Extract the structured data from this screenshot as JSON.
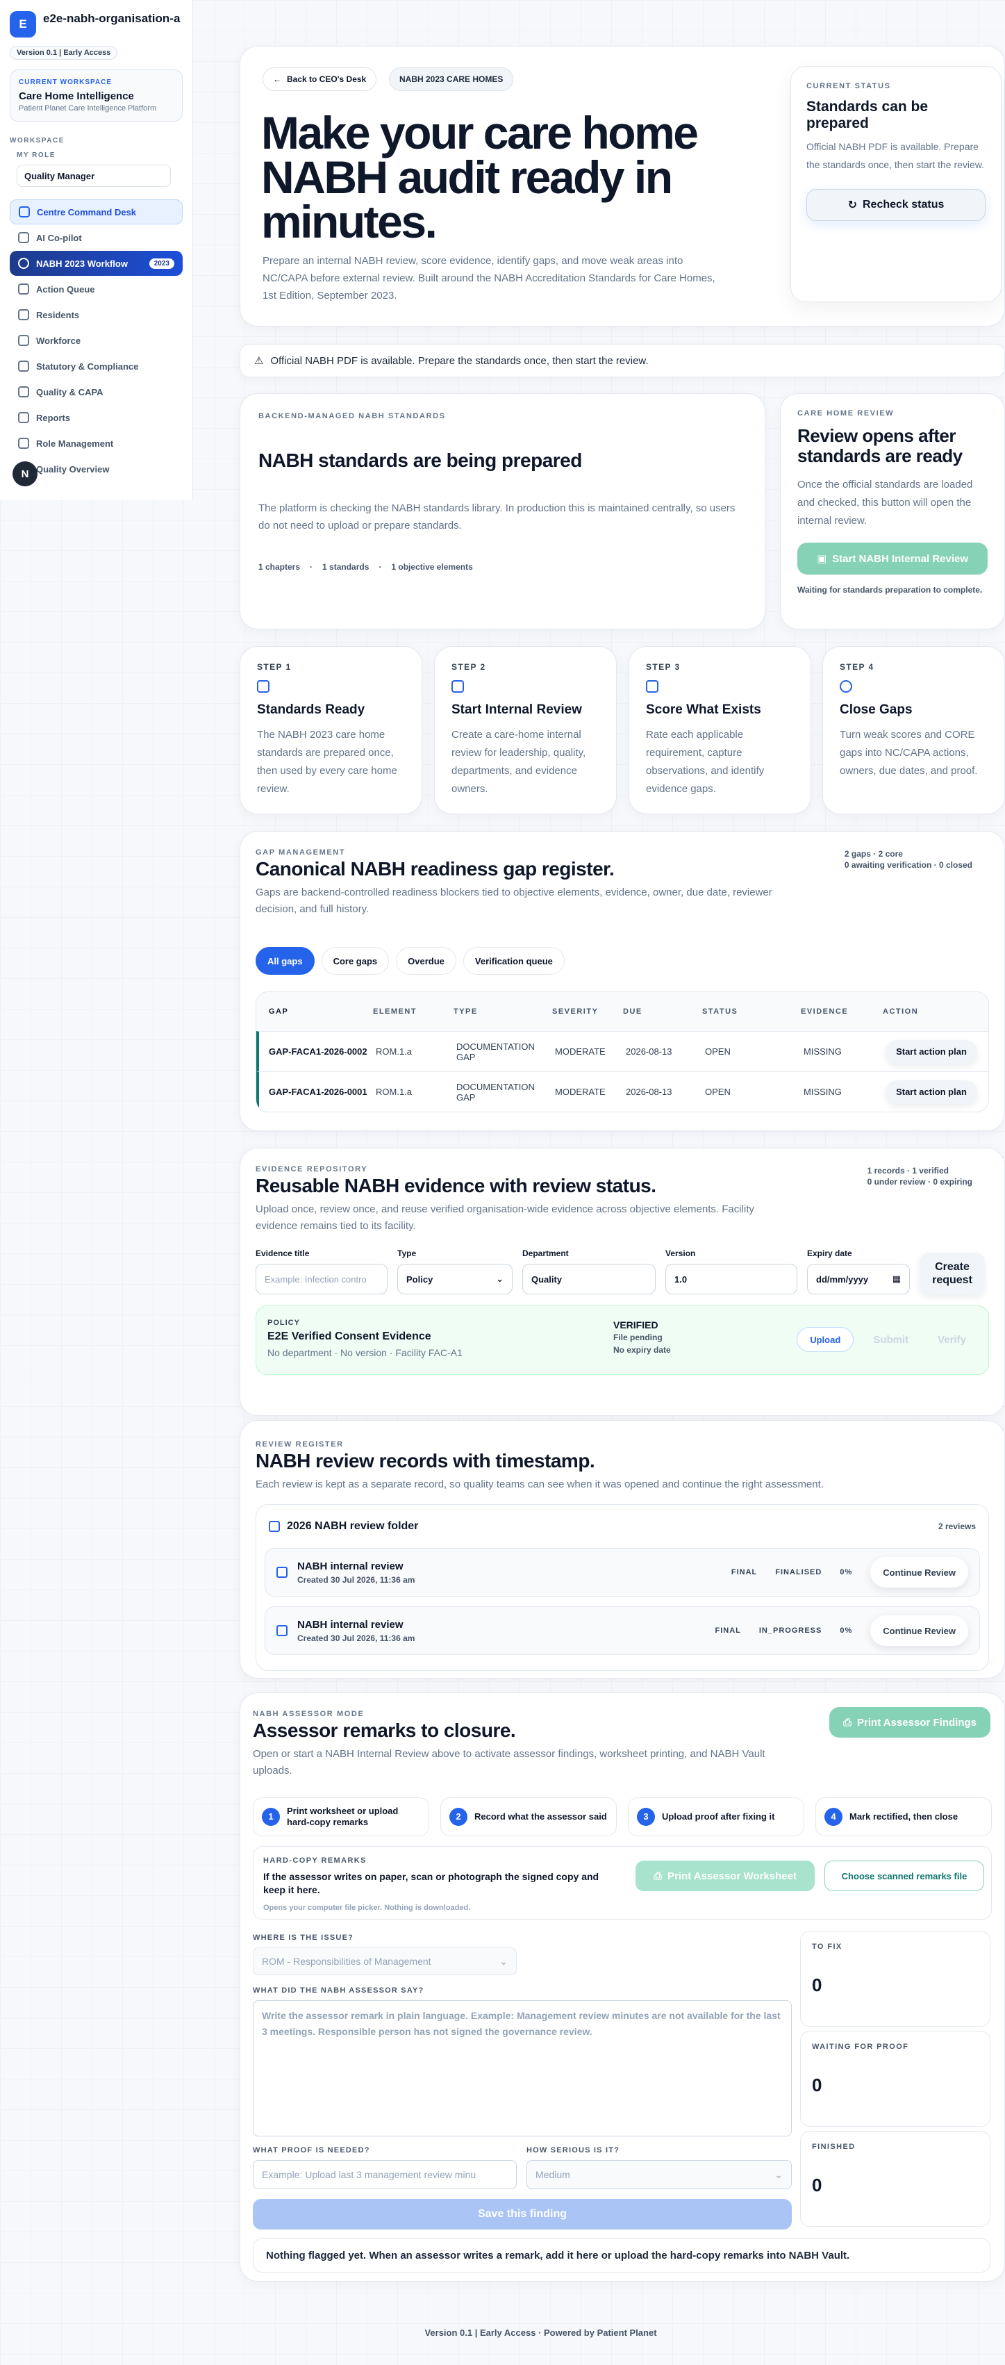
{
  "sidebar": {
    "logo_letter": "E",
    "org_name": "e2e-nabh-organisation-a",
    "version": "Version 0.1 | Early Access",
    "workspace_eyebrow": "CURRENT WORKSPACE",
    "workspace_name": "Care Home Intelligence",
    "workspace_sub": "Patient Planet Care Intelligence Platform",
    "section_label": "WORKSPACE",
    "role_label": "MY ROLE",
    "role_value": "Quality Manager",
    "items": [
      {
        "label": "Centre Command Desk",
        "icon": "grid-icon"
      },
      {
        "label": "AI Co-pilot",
        "icon": "chat-icon"
      },
      {
        "label": "NABH 2023 Workflow",
        "icon": "shield-icon",
        "badge": "2023"
      },
      {
        "label": "Action Queue",
        "icon": "clock-icon"
      },
      {
        "label": "Residents",
        "icon": "users-icon"
      },
      {
        "label": "Workforce",
        "icon": "people-icon"
      },
      {
        "label": "Statutory & Compliance",
        "icon": "shield-check-icon"
      },
      {
        "label": "Quality & CAPA",
        "icon": "quality-icon"
      },
      {
        "label": "Reports",
        "icon": "chart-icon"
      },
      {
        "label": "Role Management",
        "icon": "key-icon"
      },
      {
        "label": "Quality Overview",
        "icon": "overview-icon"
      }
    ],
    "float_badge": "N"
  },
  "hero": {
    "back_label": "Back to CEO's Desk",
    "tag": "NABH 2023 CARE HOMES",
    "title": "Make your care home NABH audit ready in minutes.",
    "description": "Prepare an internal NABH review, score evidence, identify gaps, and move weak areas into NC/CAPA before external review. Built around the NABH Accreditation Standards for Care Homes, 1st Edition, September 2023.",
    "status": {
      "eyebrow": "CURRENT STATUS",
      "title": "Standards can be prepared",
      "description": "Official NABH PDF is available. Prepare the standards once, then start the review.",
      "button": "Recheck status"
    }
  },
  "notice": "Official NABH PDF is available. Prepare the standards once, then start the review.",
  "standards": {
    "eyebrow": "BACKEND-MANAGED NABH STANDARDS",
    "title": "NABH standards are being prepared",
    "description": "The platform is checking the NABH standards library. In production this is maintained centrally, so users do not need to upload or prepare standards.",
    "meta": [
      "1 chapters",
      "1 standards",
      "1 objective elements"
    ]
  },
  "review_card": {
    "eyebrow": "CARE HOME REVIEW",
    "title": "Review opens after standards are ready",
    "description": "Once the official standards are loaded and checked, this button will open the internal review.",
    "button": "Start NABH Internal Review",
    "wait": "Waiting for standards preparation to complete."
  },
  "steps": [
    {
      "eyebrow": "STEP 1",
      "title": "Standards Ready",
      "desc": "The NABH 2023 care home standards are prepared once, then used by every care home review."
    },
    {
      "eyebrow": "STEP 2",
      "title": "Start Internal Review",
      "desc": "Create a care-home internal review for leadership, quality, departments, and evidence owners."
    },
    {
      "eyebrow": "STEP 3",
      "title": "Score What Exists",
      "desc": "Rate each applicable requirement, capture observations, and identify evidence gaps."
    },
    {
      "eyebrow": "STEP 4",
      "title": "Close Gaps",
      "desc": "Turn weak scores and CORE gaps into NC/CAPA actions, owners, due dates, and proof."
    }
  ],
  "gaps": {
    "eyebrow": "GAP MANAGEMENT",
    "title": "Canonical NABH readiness gap register.",
    "description": "Gaps are backend-controlled readiness blockers tied to objective elements, evidence, owner, due date, reviewer decision, and full history.",
    "counts": [
      "2 gaps",
      "2 core",
      "0 awaiting verification",
      "0 closed"
    ],
    "chips": [
      "All gaps",
      "Core gaps",
      "Overdue",
      "Verification queue"
    ],
    "columns": [
      "GAP",
      "ELEMENT",
      "TYPE",
      "SEVERITY",
      "DUE",
      "STATUS",
      "EVIDENCE",
      "ACTION"
    ],
    "rows": [
      {
        "gap": "GAP-FACA1-2026-0002",
        "element": "ROM.1.a",
        "type": "DOCUMENTATION GAP",
        "severity": "MODERATE",
        "due": "2026-08-13",
        "status": "OPEN",
        "evidence": "MISSING",
        "action": "Start action plan"
      },
      {
        "gap": "GAP-FACA1-2026-0001",
        "element": "ROM.1.a",
        "type": "DOCUMENTATION GAP",
        "severity": "MODERATE",
        "due": "2026-08-13",
        "status": "OPEN",
        "evidence": "MISSING",
        "action": "Start action plan"
      }
    ]
  },
  "evidence": {
    "eyebrow": "EVIDENCE REPOSITORY",
    "title": "Reusable NABH evidence with review status.",
    "description": "Upload once, review once, and reuse verified organisation-wide evidence across objective elements. Facility evidence remains tied to its facility.",
    "counts": [
      "1 records",
      "1 verified",
      "0 under review",
      "0 expiring"
    ],
    "form": {
      "title_label": "Evidence title",
      "title_placeholder": "Example: Infection contro",
      "type_label": "Type",
      "type_value": "Policy",
      "dept_label": "Department",
      "dept_value": "Quality",
      "version_label": "Version",
      "version_value": "1.0",
      "expiry_label": "Expiry date",
      "expiry_value": "dd/mm/yyyy",
      "create_button": "Create request"
    },
    "record": {
      "type": "POLICY",
      "name": "E2E Verified Consent Evidence",
      "sub": "No department · No version · Facility FAC-A1",
      "status": "VERIFIED",
      "file": "File pending",
      "expiry": "No expiry date",
      "upload": "Upload",
      "submit": "Submit",
      "verify": "Verify"
    }
  },
  "register": {
    "eyebrow": "REVIEW REGISTER",
    "title": "NABH review records with timestamp.",
    "description": "Each review is kept as a separate record, so quality teams can see when it was opened and continue the right assessment.",
    "folder_title": "2026 NABH review folder",
    "folder_count": "2 reviews",
    "records": [
      {
        "name": "NABH internal review",
        "date": "Created 30 Jul 2026, 11:36 am",
        "tag1": "FINAL",
        "tag2": "FINALISED",
        "pct": "0%",
        "button": "Continue Review"
      },
      {
        "name": "NABH internal review",
        "date": "Created 30 Jul 2026, 11:36 am",
        "tag1": "FINAL",
        "tag2": "IN_PROGRESS",
        "pct": "0%",
        "button": "Continue Review"
      }
    ]
  },
  "assessor": {
    "eyebrow": "NABH ASSESSOR MODE",
    "title": "Assessor remarks to closure.",
    "description": "Open or start a NABH Internal Review above to activate assessor findings, worksheet printing, and NABH Vault uploads.",
    "print_button": "Print Assessor Findings",
    "steps": [
      {
        "num": "1",
        "label": "Print worksheet or upload hard-copy remarks"
      },
      {
        "num": "2",
        "label": "Record what the assessor said"
      },
      {
        "num": "3",
        "label": "Upload proof after fixing it"
      },
      {
        "num": "4",
        "label": "Mark rectified, then close"
      }
    ],
    "hardcopy": {
      "eyebrow": "HARD-COPY REMARKS",
      "text": "If the assessor writes on paper, scan or photograph the signed copy and keep it here.",
      "sub": "Opens your computer file picker. Nothing is downloaded.",
      "print": "Print Assessor Worksheet",
      "choose": "Choose scanned remarks file"
    },
    "form": {
      "where_label": "WHERE IS THE ISSUE?",
      "where_value": "ROM - Responsibilities of Management",
      "what_label": "WHAT DID THE NABH ASSESSOR SAY?",
      "what_placeholder": "Write the assessor remark in plain language. Example: Management review minutes are not available for the last 3 meetings. Responsible person has not signed the governance review.",
      "proof_label": "WHAT PROOF IS NEEDED?",
      "proof_placeholder": "Example: Upload last 3 management review minu",
      "serious_label": "HOW SERIOUS IS IT?",
      "serious_value": "Medium",
      "save": "Save this finding"
    },
    "stats": [
      {
        "label": "TO FIX",
        "value": "0"
      },
      {
        "label": "WAITING FOR PROOF",
        "value": "0"
      },
      {
        "label": "FINISHED",
        "value": "0"
      }
    ],
    "empty": "Nothing flagged yet. When an assessor writes a remark, add it here or upload the hard-copy remarks into NABH Vault."
  },
  "footer": "Version 0.1 | Early Access · Powered by Patient Planet"
}
